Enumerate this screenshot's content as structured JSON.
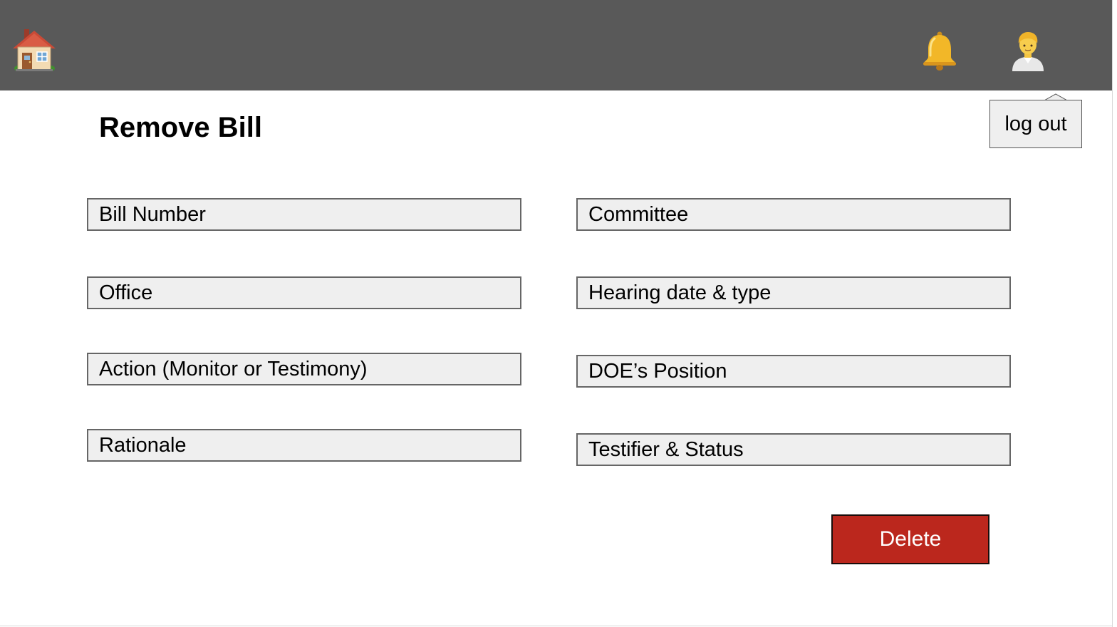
{
  "header": {
    "home_icon": "home-icon",
    "notification_icon": "bell-icon",
    "user_icon": "user-avatar-icon",
    "background_color": "#595959"
  },
  "user_menu": {
    "logout_label": "log out"
  },
  "page": {
    "title": "Remove Bill"
  },
  "form": {
    "left_fields": [
      {
        "placeholder": "Bill Number"
      },
      {
        "placeholder": "Office"
      },
      {
        "placeholder": "Action (Monitor or Testimony)"
      },
      {
        "placeholder": "Rationale"
      }
    ],
    "right_fields": [
      {
        "placeholder": "Committee"
      },
      {
        "placeholder": "Hearing date & type"
      },
      {
        "placeholder": "DOE’s Position"
      },
      {
        "placeholder": "Testifier & Status"
      }
    ]
  },
  "actions": {
    "delete_label": "Delete",
    "delete_color": "#bb271d"
  }
}
